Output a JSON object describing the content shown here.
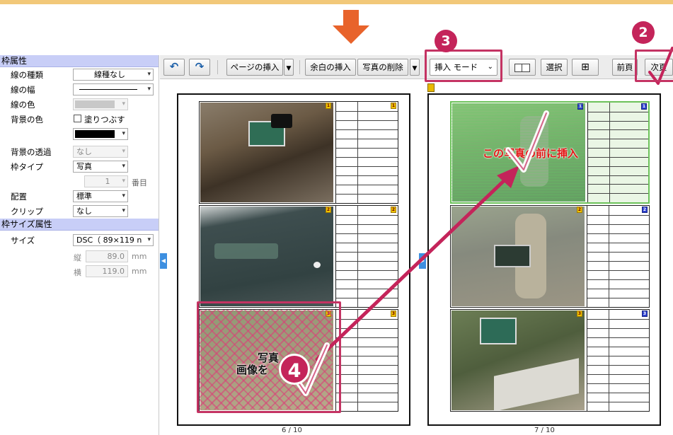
{
  "colors": {
    "accent": "#c4245a",
    "panel_header": "#c8cef7",
    "insert_text": "#e21515",
    "arrow": "#e8632b"
  },
  "panel": {
    "frame_section": "枠属性",
    "line_type": {
      "label": "線の種類",
      "value": "線種なし"
    },
    "line_width": {
      "label": "線の幅"
    },
    "line_color": {
      "label": "線の色"
    },
    "bg_color": {
      "label": "背景の色",
      "fill_label": "塗りつぶす"
    },
    "bg_transparency": {
      "label": "背景の透過",
      "value": "なし"
    },
    "frame_type": {
      "label": "枠タイプ",
      "value": "写真"
    },
    "number": {
      "value": "1",
      "suffix": "番目"
    },
    "placement": {
      "label": "配置",
      "value": "標準"
    },
    "clip": {
      "label": "クリップ",
      "value": "なし"
    },
    "size_section": "枠サイズ属性",
    "size": {
      "label": "サイズ",
      "value": "DSC（ 89×119 n"
    },
    "height": {
      "label": "縦",
      "value": "89.0",
      "unit": "mm"
    },
    "width": {
      "label": "横",
      "value": "119.0",
      "unit": "mm"
    }
  },
  "toolbar": {
    "undo_icon": "undo-icon",
    "redo_icon": "redo-icon",
    "insert_page": "ページの挿入",
    "insert_margin": "余白の挿入",
    "delete_photo": "写真の削除",
    "mode": "挿入 モード",
    "select": "選択",
    "prev_page": "前頁",
    "next_page": "次頁"
  },
  "pages": {
    "left_num": "6 / 10",
    "right_num": "7 / 10"
  },
  "overlays": {
    "insert_here": "この写真の前に挿入",
    "drag_text_1": "写真",
    "drag_text_2": "画像を"
  },
  "steps": {
    "step2": "2",
    "step3": "3",
    "step4": "4"
  },
  "badges": [
    "1",
    "2",
    "3"
  ]
}
